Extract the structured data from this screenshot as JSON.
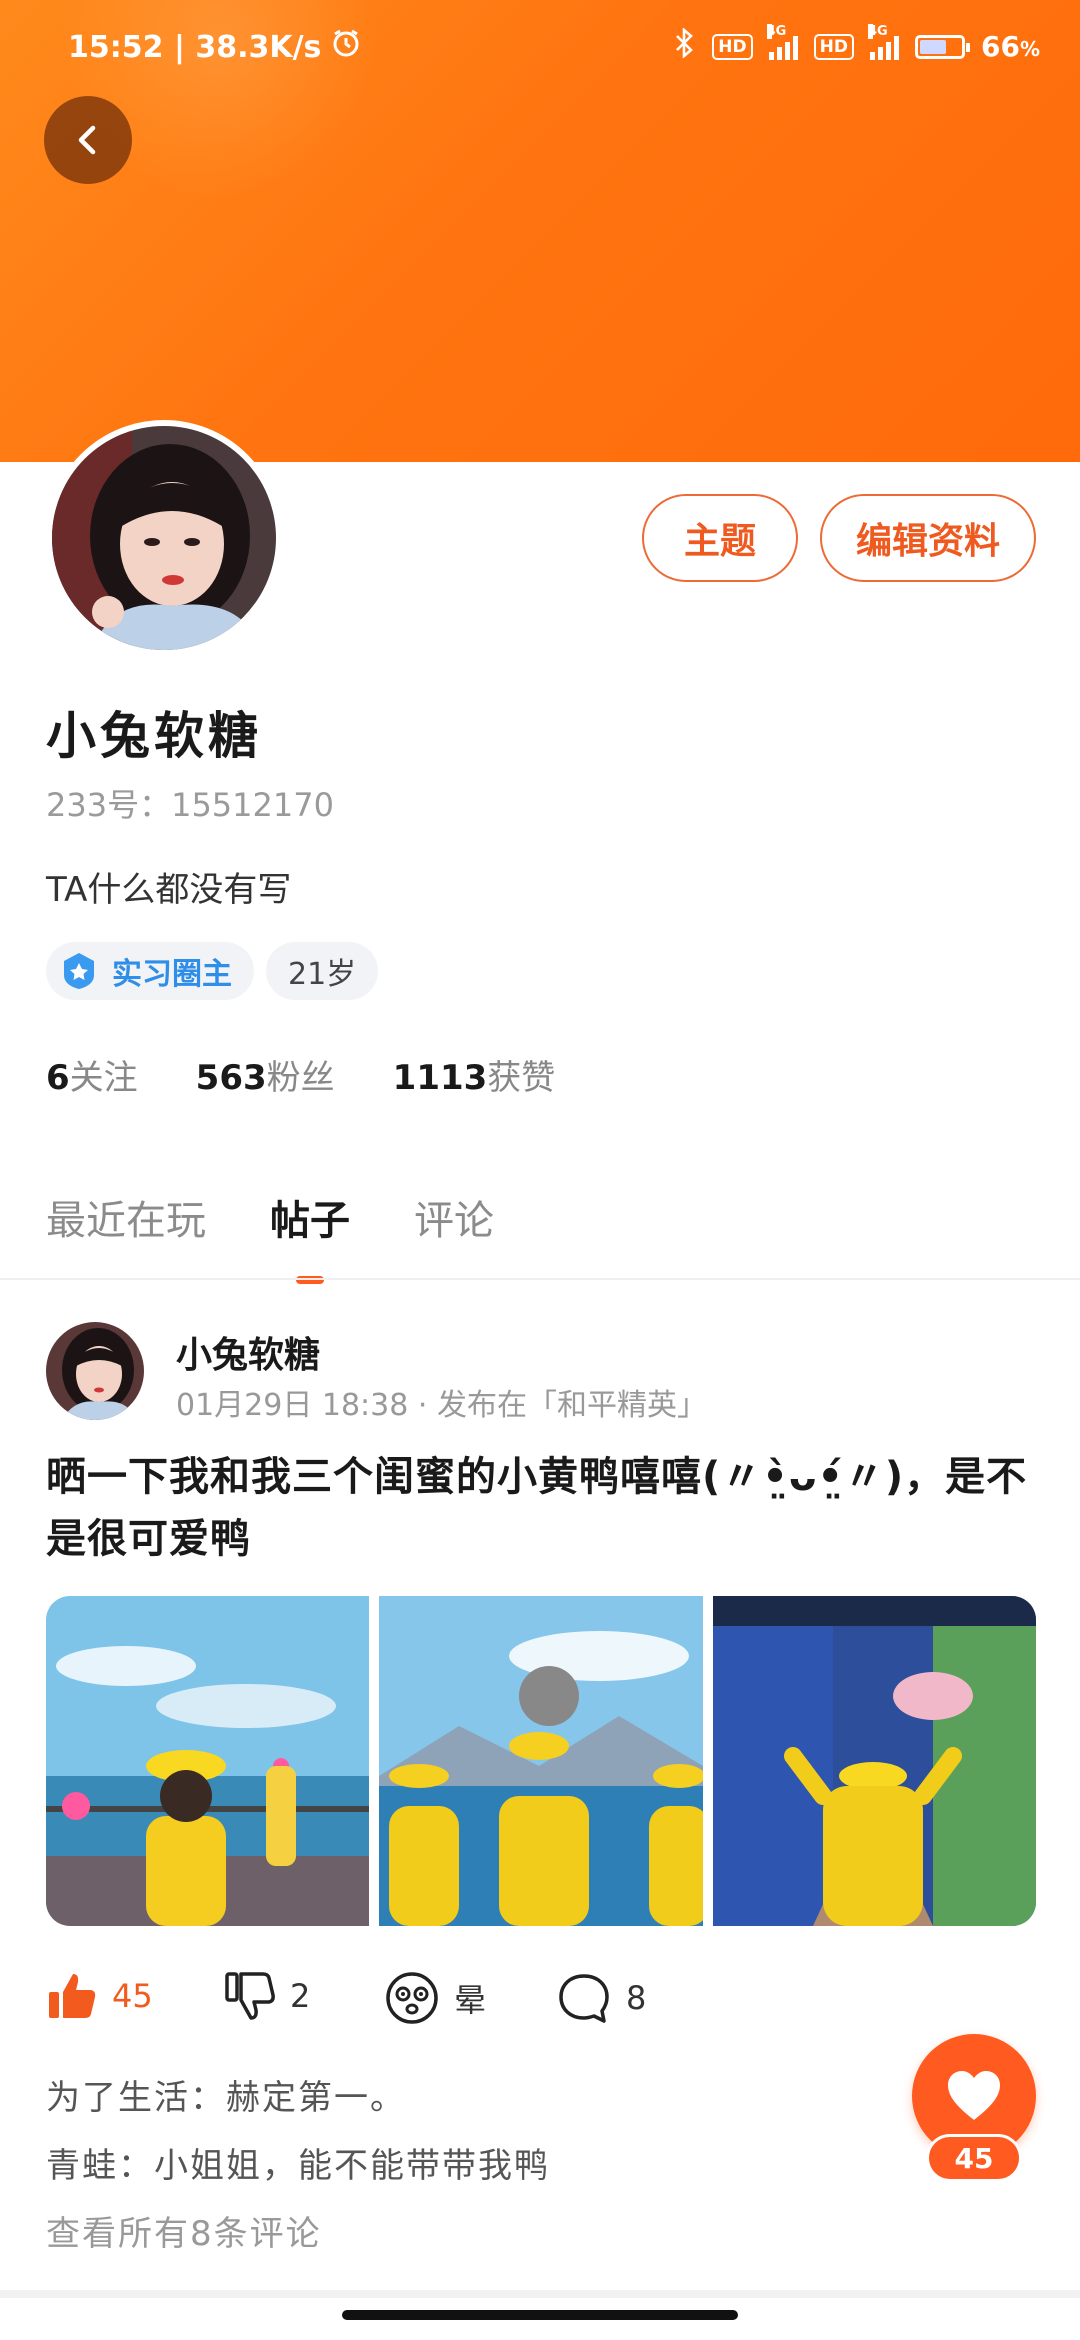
{
  "status_bar": {
    "time_speed": "15:52 | 38.3K/s",
    "hd_label": "HD",
    "net_label": "4G",
    "battery": "66",
    "battery_unit": "%",
    "icons": [
      "alarm-icon",
      "bluetooth-icon",
      "signal-icon",
      "battery-icon"
    ]
  },
  "colors": {
    "accent": "#ff5a1f",
    "banner": "#ff7410",
    "badge_blue": "#2f8ee8"
  },
  "profile": {
    "theme_button": "主题",
    "edit_button": "编辑资料",
    "name": "小兔软糖",
    "uid": "233号：15512170",
    "bio": "TA什么都没有写",
    "badge": "实习圈主",
    "age": "21岁",
    "stats": [
      {
        "value": "6",
        "label": "关注"
      },
      {
        "value": "563",
        "label": "粉丝"
      },
      {
        "value": "1113",
        "label": "获赞"
      }
    ]
  },
  "tabs": [
    "最近在玩",
    "帖子",
    "评论"
  ],
  "active_tab": "帖子",
  "post": {
    "author": "小兔软糖",
    "meta": "01月29日 18:38 · 发布在「和平精英」",
    "text": "晒一下我和我三个闺蜜的小黄鸭嘻嘻(〃•̤̀ᴗ•̤́〃)，是不是很可爱鸭",
    "likes": "45",
    "dislikes": "2",
    "dizzy": "晕",
    "comments_count": "8",
    "comments": [
      "为了生活：赫定第一。",
      "青蛙：小姐姐，能不能带带我鸭"
    ],
    "view_all": "查看所有8条评论"
  },
  "fab": {
    "count": "45"
  }
}
